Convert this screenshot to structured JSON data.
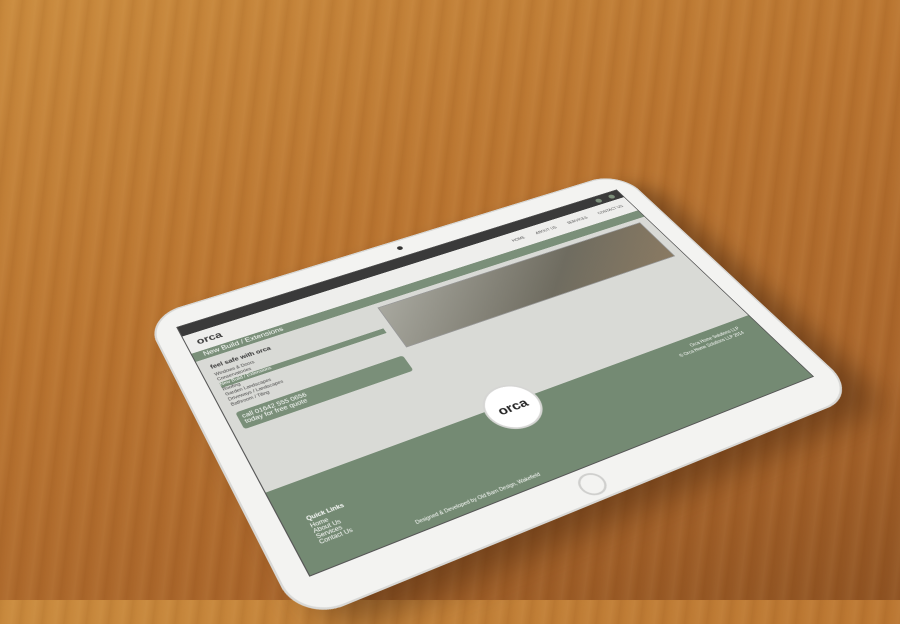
{
  "screen": {
    "nav": [
      "HOME",
      "ABOUT US",
      "SERVICES",
      "CONTACT US"
    ],
    "logo": "orca",
    "banner_title": "New Build / Extensions",
    "tagline": "feel safe with orca",
    "services_list": [
      "Windows & Doors",
      "Conservatories",
      "New Build / Extensions",
      "Roofing",
      "Garden Landscapes",
      "Driveways / Landscapes",
      "Bathroom / Tiling"
    ],
    "selected_index": 2,
    "call_line1": "call 01642 555 0656",
    "call_line2": "today for free quote",
    "footer": {
      "badge": "orca",
      "company": "Orca Home Solutions LLP",
      "quick_links_heading": "Quick Links",
      "quick_links": [
        "Home",
        "About Us",
        "Services",
        "Contact Us"
      ],
      "credit": "Designed & Developed by Old Barn Design, Wakefield",
      "copyright": "© Orca Home Solutions LLP 2014"
    }
  },
  "colors": {
    "accent": "#7a8f79",
    "footer": "#748a73",
    "wood": "#b97430"
  }
}
